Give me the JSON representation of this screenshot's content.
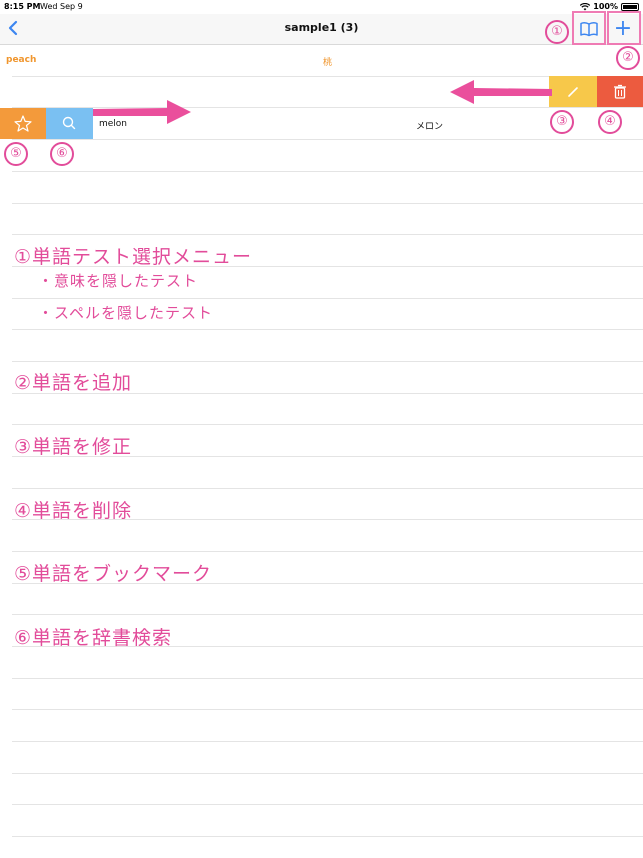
{
  "status_bar": {
    "time": "8:15 PM",
    "date": "Wed Sep 9",
    "battery": "100%"
  },
  "nav": {
    "title": "sample1 (3)"
  },
  "rows": [
    {
      "word": "peach",
      "meaning": "桃"
    },
    {
      "word": "melon",
      "meaning": "メロン"
    }
  ],
  "annotations": {
    "markers": [
      "①",
      "②",
      "③",
      "④",
      "⑤",
      "⑥"
    ],
    "items": [
      "①単語テスト選択メニュー",
      "・意味を隠したテスト",
      "・スペルを隠したテスト",
      "②単語を追加",
      "③単語を修正",
      "④単語を削除",
      "⑤単語をブックマーク",
      "⑥単語を辞書検索"
    ]
  },
  "colors": {
    "accent": "#3d86f0",
    "bookmark": "#f39a3b",
    "search": "#7ac0f2",
    "edit": "#f7c84a",
    "delete": "#ec5b3f",
    "annotation": "#e24c9a",
    "peach_text": "#f0962e"
  },
  "icons": [
    "chevron-left-icon",
    "book-icon",
    "plus-icon",
    "pencil-icon",
    "trash-icon",
    "star-icon",
    "magnifier-icon"
  ]
}
